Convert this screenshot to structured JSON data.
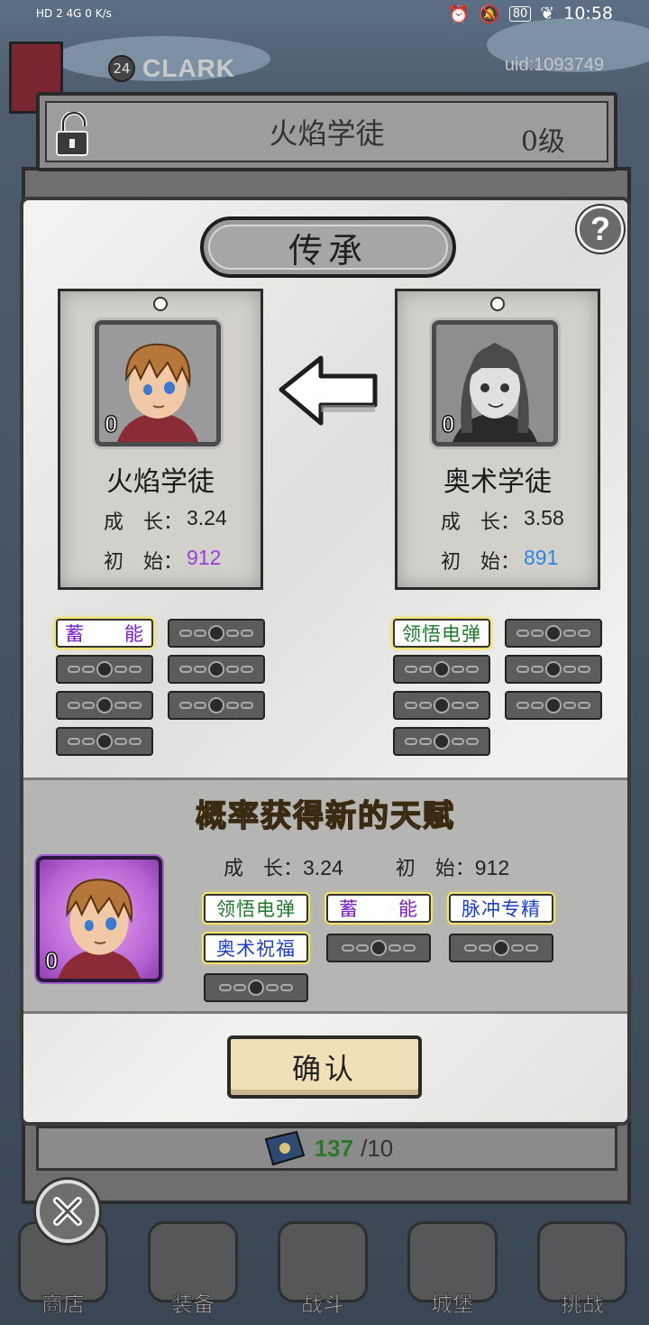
{
  "status_bar": {
    "left": "HD 2  4G  0 K/s",
    "battery": "80",
    "time": "10:58"
  },
  "player": {
    "level": "24",
    "name": "CLARK",
    "uid": "uid:1093749"
  },
  "title_panel": {
    "name": "火焰学徒",
    "level": "0级"
  },
  "modal": {
    "header": "传承",
    "help": "?",
    "left_card": {
      "level": "0",
      "name": "火焰学徒",
      "growth_label": "成　长：",
      "growth_value": "3.24",
      "initial_label": "初　始：",
      "initial_value": "912",
      "initial_color": "#9a3fd9",
      "talents": [
        "蓄　　能"
      ],
      "talent_colors": [
        "#7a1fc0"
      ]
    },
    "right_card": {
      "level": "0",
      "name": "奥术学徒",
      "growth_label": "成　长：",
      "growth_value": "3.58",
      "initial_label": "初　始：",
      "initial_value": "891",
      "initial_color": "#2c86e0",
      "talents": [
        "领悟电弹"
      ],
      "talent_colors": [
        "#1f7a2c"
      ]
    },
    "result": {
      "title": "概率获得新的天赋",
      "level": "0",
      "growth_label": "成　长：",
      "growth_value": "3.24",
      "initial_label": "初　始：",
      "initial_value": "912",
      "talents": [
        "领悟电弹",
        "蓄　　能",
        "脉冲专精",
        "奥术祝福"
      ],
      "talent_colors": [
        "#1f7a2c",
        "#7a1fc0",
        "#1f3fc8",
        "#1f3fc8"
      ]
    },
    "confirm": "确认"
  },
  "counter": {
    "current": "137",
    "max": "/10"
  },
  "navbar": [
    "商店",
    "装备",
    "战斗",
    "城堡",
    "挑战"
  ]
}
